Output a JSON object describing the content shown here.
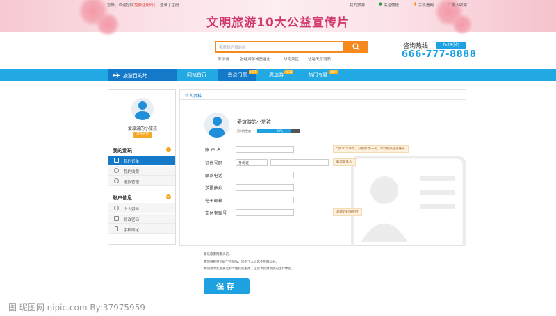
{
  "topbar": {
    "greeting": "您好，欢迎您回",
    "login_prompt": "[免费注册吗]",
    "login_register": "登录 | 注册",
    "my_travel": "我的旅游",
    "follow_wechat": "关注微信",
    "mobile": "手机看网",
    "favorite": "加入收藏"
  },
  "banner": {
    "title": "文明旅游10大公益宣传片"
  },
  "search": {
    "placeholder": "搜索目的目的地",
    "hot_words": [
      "乐华城",
      "张蛙湖郁城堡酒庄",
      "华南景区",
      "达哈天厚道质"
    ]
  },
  "hotline": {
    "label": "咨询热线",
    "badge": "7x24小时",
    "number": "666-777-8888"
  },
  "nav": {
    "destination": "旅游目的地",
    "items": [
      {
        "label": "网站首页"
      },
      {
        "label": "景点门票",
        "badge": "HOT"
      },
      {
        "label": "周边游",
        "badge": "NEW"
      },
      {
        "label": "热门专题",
        "badge": "HOT"
      }
    ]
  },
  "sidebar": {
    "username": "爱旅游的小旅孩",
    "member_badge": "普通会员",
    "group1": {
      "title": "我的爱玩",
      "items": [
        "我的订单",
        "我的收藏",
        "退款管理"
      ]
    },
    "group2": {
      "title": "账户信息",
      "items": [
        "个人资料",
        "修改密码",
        "手机绑定"
      ]
    }
  },
  "main": {
    "tab": "个人资料",
    "username": "爱旅游的小旅孩",
    "progress_label": "资料完整度",
    "progress_pct": 0.8,
    "progress_text": "80%",
    "fields": {
      "account": "账 户 名",
      "id_number": "证件号码",
      "id_type": "身份证",
      "phone": "联系电话",
      "address": "送票地址",
      "email": "电子邮箱",
      "alipay": "支付宝账号"
    },
    "tips": {
      "account": "5到10个字母，只能修改一次，可以用来登录账号",
      "id": "取票联系人",
      "alipay": "退款的转账使用"
    }
  },
  "notes": {
    "title": "爱玩旅游网重承诺：",
    "line1": "我们将尊重您的个人隐私，您的个人信息不会被公开。",
    "line2": "我们会为您量身定制个性化的服务，让您享受更优质的出行体验。"
  },
  "save_label": "保存",
  "watermark": "图 昵图网 nipic.com  By:37975959"
}
